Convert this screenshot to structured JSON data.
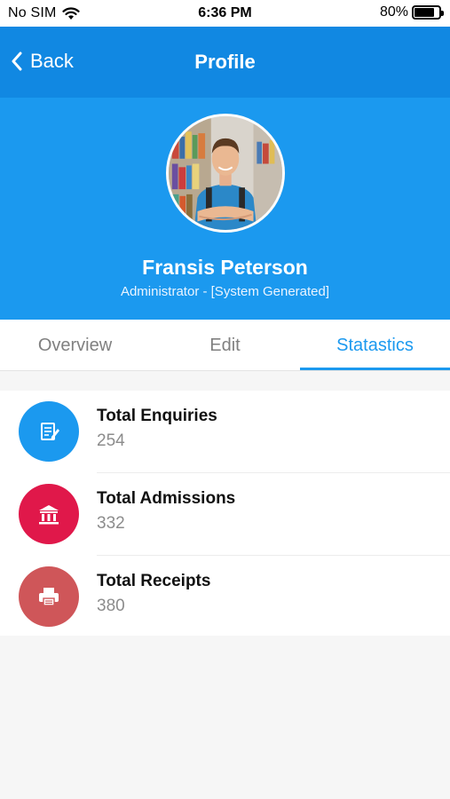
{
  "status_bar": {
    "carrier": "No SIM",
    "time": "6:36 PM",
    "battery": "80%",
    "battery_level": 0.8
  },
  "nav": {
    "back_label": "Back",
    "title": "Profile"
  },
  "profile": {
    "name": "Fransis Peterson",
    "role": "Administrator - [System Generated]"
  },
  "tabs": [
    {
      "label": "Overview",
      "active": false
    },
    {
      "label": "Edit",
      "active": false
    },
    {
      "label": "Statastics",
      "active": true
    }
  ],
  "stats": [
    {
      "label": "Total Enquiries",
      "value": "254",
      "icon": "document-edit-icon",
      "color": "#1b99ef"
    },
    {
      "label": "Total Admissions",
      "value": "332",
      "icon": "institution-icon",
      "color": "#e0184a"
    },
    {
      "label": "Total Receipts",
      "value": "380",
      "icon": "printer-icon",
      "color": "#cf5659"
    }
  ],
  "colors": {
    "nav_bg": "#1188e2",
    "header_bg": "#1b99ef",
    "accent": "#1b99ef"
  }
}
